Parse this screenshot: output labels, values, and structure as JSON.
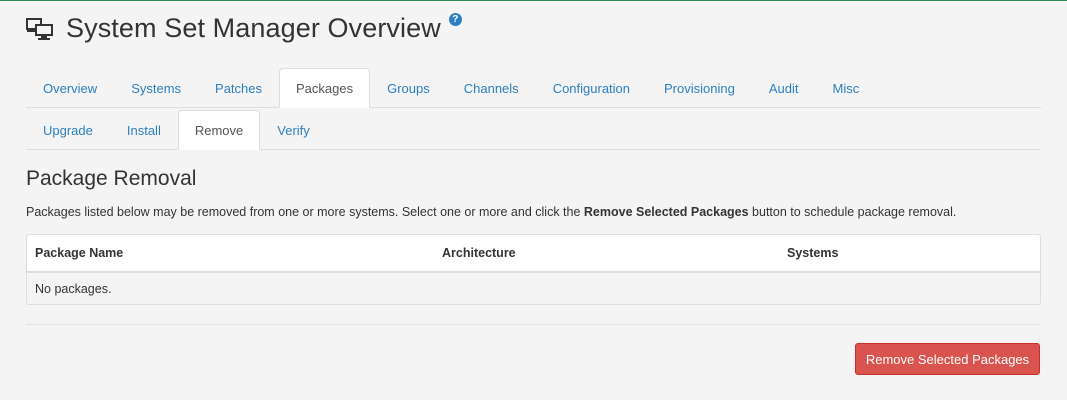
{
  "page": {
    "title": "System Set Manager Overview",
    "help_icon": "?"
  },
  "tabs_primary": [
    {
      "label": "Overview"
    },
    {
      "label": "Systems"
    },
    {
      "label": "Patches"
    },
    {
      "label": "Packages"
    },
    {
      "label": "Groups"
    },
    {
      "label": "Channels"
    },
    {
      "label": "Configuration"
    },
    {
      "label": "Provisioning"
    },
    {
      "label": "Audit"
    },
    {
      "label": "Misc"
    }
  ],
  "tabs_secondary": [
    {
      "label": "Upgrade"
    },
    {
      "label": "Install"
    },
    {
      "label": "Remove"
    },
    {
      "label": "Verify"
    }
  ],
  "section": {
    "title": "Package Removal",
    "desc_before": "Packages listed below may be removed from one or more systems. Select one or more and click the ",
    "desc_bold": "Remove Selected Packages",
    "desc_after": " button to schedule package removal."
  },
  "table": {
    "columns": [
      "Package Name",
      "Architecture",
      "Systems"
    ],
    "empty_text": "No packages."
  },
  "actions": {
    "remove_label": "Remove Selected Packages"
  },
  "colors": {
    "link": "#2d7fc1",
    "danger": "#d9534f",
    "accent_top": "#2e8b57"
  }
}
